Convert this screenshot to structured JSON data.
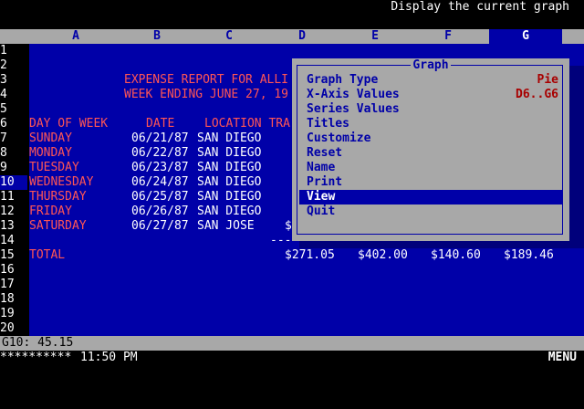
{
  "status": "Display the current graph",
  "columns": [
    "A",
    "B",
    "C",
    "D",
    "E",
    "F",
    "G"
  ],
  "selected_column": "G",
  "rows": [
    "1",
    "2",
    "3",
    "4",
    "5",
    "6",
    "7",
    "8",
    "9",
    "10",
    "11",
    "12",
    "13",
    "14",
    "15",
    "16",
    "17",
    "18",
    "19",
    "20"
  ],
  "selected_row": "10",
  "sheet": {
    "title1": "EXPENSE REPORT FOR ALLI",
    "title2": "WEEK ENDING JUNE 27, 19",
    "hdr_day": "DAY OF WEEK",
    "hdr_date": "DATE",
    "hdr_loc": "LOCATION TRA",
    "entries": [
      {
        "day": "SUNDAY",
        "date": "06/21/87",
        "loc": "SAN DIEGO"
      },
      {
        "day": "MONDAY",
        "date": "06/22/87",
        "loc": "SAN DIEGO"
      },
      {
        "day": "TUESDAY",
        "date": "06/23/87",
        "loc": "SAN DIEGO"
      },
      {
        "day": "WEDNESDAY",
        "date": "06/24/87",
        "loc": "SAN DIEGO"
      },
      {
        "day": "THURSDAY",
        "date": "06/25/87",
        "loc": "SAN DIEGO"
      },
      {
        "day": "FRIDAY",
        "date": "06/26/87",
        "loc": "SAN DIEGO"
      },
      {
        "day": "SATURDAY",
        "date": "06/27/87",
        "loc": "SAN JOSE"
      }
    ],
    "sat_d_partial": "$",
    "underline": "----",
    "total_label": "TOTAL",
    "totals": [
      "$271.05",
      "$402.00",
      "$140.60",
      "$189.46"
    ]
  },
  "menu": {
    "title": "Graph",
    "items": [
      {
        "label": "Graph Type",
        "value": "Pie"
      },
      {
        "label": "X-Axis Values",
        "value": "D6..G6"
      },
      {
        "label": "Series Values",
        "value": ""
      },
      {
        "label": "Titles",
        "value": ""
      },
      {
        "label": "Customize",
        "value": ""
      },
      {
        "label": "Reset",
        "value": ""
      },
      {
        "label": "Name",
        "value": ""
      },
      {
        "label": "Print",
        "value": ""
      },
      {
        "label": "View",
        "value": ""
      },
      {
        "label": "Quit",
        "value": ""
      }
    ],
    "highlighted": "View"
  },
  "cell_indicator": "G10: 45.15",
  "footer": {
    "stars": "**********",
    "time": "11:50 PM",
    "menu_label": "MENU"
  }
}
